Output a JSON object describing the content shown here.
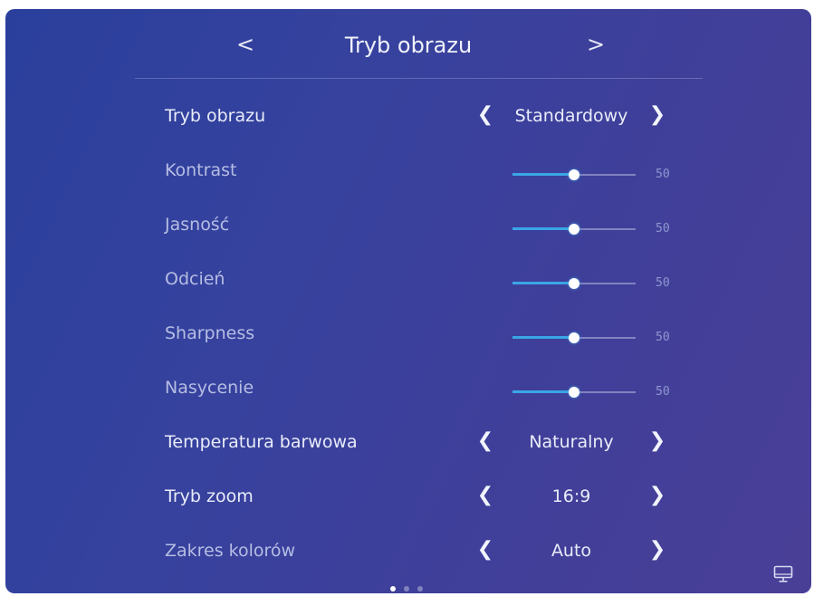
{
  "header": {
    "title": "Tryb obrazu",
    "prev": "<",
    "next": ">"
  },
  "settings": [
    {
      "label": "Tryb obrazu",
      "type": "selector",
      "value": "Standardowy"
    },
    {
      "label": "Kontrast",
      "type": "slider",
      "value": "50"
    },
    {
      "label": "Jasność",
      "type": "slider",
      "value": "50"
    },
    {
      "label": "Odcień",
      "type": "slider",
      "value": "50"
    },
    {
      "label": "Sharpness",
      "type": "slider",
      "value": "50"
    },
    {
      "label": "Nasycenie",
      "type": "slider",
      "value": "50"
    },
    {
      "label": "Temperatura barwowa",
      "type": "selector",
      "value": "Naturalny"
    },
    {
      "label": "Tryb zoom",
      "type": "selector",
      "value": "16:9"
    },
    {
      "label": "Zakres kolorów",
      "type": "selector",
      "value": "Auto"
    }
  ],
  "slider_max": 100,
  "page_indicator": {
    "pages": 3,
    "active": 1
  },
  "icons": {
    "bottom_right": "monitor-icon"
  },
  "colors": {
    "accent": "#3aa6e6",
    "background": "#353f9c"
  }
}
